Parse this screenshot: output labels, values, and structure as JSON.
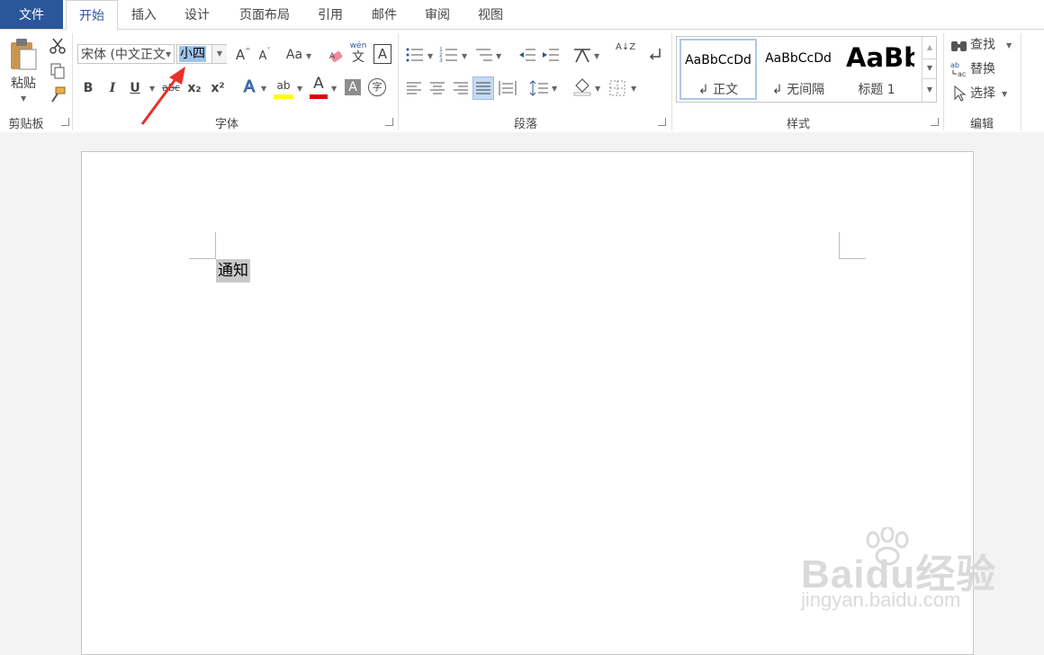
{
  "tabs": [
    {
      "label": "文件"
    },
    {
      "label": "开始"
    },
    {
      "label": "插入"
    },
    {
      "label": "设计"
    },
    {
      "label": "页面布局"
    },
    {
      "label": "引用"
    },
    {
      "label": "邮件"
    },
    {
      "label": "审阅"
    },
    {
      "label": "视图"
    }
  ],
  "clipboard": {
    "paste_label": "粘贴",
    "group_label": "剪贴板"
  },
  "font": {
    "font_name": "宋体 (中文正文",
    "font_size": "小四",
    "grow_label": "A",
    "shrink_label": "A",
    "case_label": "Aa",
    "phonetic_top": "wén",
    "phonetic_bottom": "文",
    "border_char_label": "A",
    "bold": "B",
    "italic": "I",
    "underline": "U",
    "strike": "abc",
    "subscript": "x₂",
    "superscript": "x²",
    "text_effect": "A",
    "highlight": "ab",
    "font_color": "A",
    "char_shading": "A",
    "enclose": "字",
    "group_label": "字体"
  },
  "paragraph": {
    "sort_label": "A↓Z",
    "group_label": "段落"
  },
  "styles": {
    "items": [
      {
        "sample": "AaBbCcDd",
        "name": "↲ 正文"
      },
      {
        "sample": "AaBbCcDd",
        "name": "↲ 无间隔"
      },
      {
        "sample": "AaBb",
        "name": "标题 1"
      }
    ],
    "group_label": "样式"
  },
  "editing": {
    "find": "查找",
    "replace": "替换",
    "select": "选择",
    "group_label": "编辑"
  },
  "document": {
    "text": "通知"
  },
  "watermark": {
    "brand": "Baidu经验",
    "url": "jingyan.baidu.com"
  },
  "colors": {
    "file_tab": "#2b579a",
    "accent": "#2b579a",
    "arrow": "#e8312a",
    "highlight_bar": "#ffff00",
    "font_color_bar": "#e00000"
  }
}
